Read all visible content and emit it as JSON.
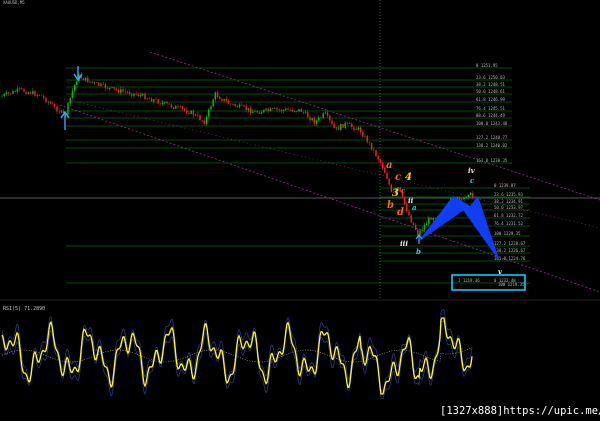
{
  "colors": {
    "background": "#000000",
    "candle_up": "#00c800",
    "candle_down": "#ff2020",
    "fib_line": "#00a000",
    "channel": "#9a2a9a",
    "pattern": "#1040ff",
    "rsi": "#ffff00",
    "rsi_band": "#3a3aa0",
    "target_box": "#00d0ff",
    "arrow": "#33aaff",
    "wave_orange": "#ff6a00",
    "wave_yellow": "#ffcc00",
    "wave_cyan": "#33ccff",
    "wave_white": "#e6e6e6"
  },
  "chart_data": [
    {
      "type": "candlestick",
      "title": "",
      "fib_levels": [
        {
          "label": "0 1251.95"
        },
        {
          "label": "23.6 1250.03"
        },
        {
          "label": "38.2 1248.51"
        },
        {
          "label": "50.0 1248.61"
        },
        {
          "label": "61.8 1246.99"
        },
        {
          "label": "76.4 1245.51"
        },
        {
          "label": "88.6 1244.49"
        },
        {
          "label": "100.0 1243.48"
        },
        {
          "label": "127.2 1240.77"
        },
        {
          "label": "138.2 1240.02"
        },
        {
          "label": "161.8 1238.35"
        },
        {
          "label": "0 1239.87"
        },
        {
          "label": "23.6 1235.93"
        },
        {
          "label": "38.2 1234.91"
        },
        {
          "label": "50.0 1233.97"
        },
        {
          "label": "61.8 1232.72"
        },
        {
          "label": "76.4 1231.52"
        },
        {
          "label": "100 1229.35"
        },
        {
          "label": "127.2 1228.67"
        },
        {
          "label": "138.2 1226.67"
        },
        {
          "label": "161.8 1224.76"
        },
        {
          "label": "0 1232.48"
        }
      ],
      "target_box_labels": [
        "1 1219.36",
        "100 1219.35"
      ],
      "wave_labels": [
        {
          "text": "a",
          "color": "orange"
        },
        {
          "text": "c",
          "color": "orange"
        },
        {
          "text": "4",
          "color": "yellow"
        },
        {
          "text": "3",
          "color": "yellow"
        },
        {
          "text": "c",
          "color": "orange"
        },
        {
          "text": "b",
          "color": "orange"
        },
        {
          "text": "ii",
          "color": "white"
        },
        {
          "text": "a",
          "color": "cyan"
        },
        {
          "text": "d",
          "color": "orange"
        },
        {
          "text": "iii",
          "color": "white"
        },
        {
          "text": "iv",
          "color": "white"
        },
        {
          "text": "c",
          "color": "cyan"
        },
        {
          "text": "b",
          "color": "cyan"
        },
        {
          "text": "v",
          "color": "white"
        }
      ]
    },
    {
      "type": "line",
      "title": "RSI(5) 71.2890",
      "series": [
        {
          "name": "RSI(5)",
          "last_value": 71.289
        }
      ]
    }
  ],
  "watermark": "[1327x888]https://upic.me/",
  "header_text": "XAUUSD,M5"
}
